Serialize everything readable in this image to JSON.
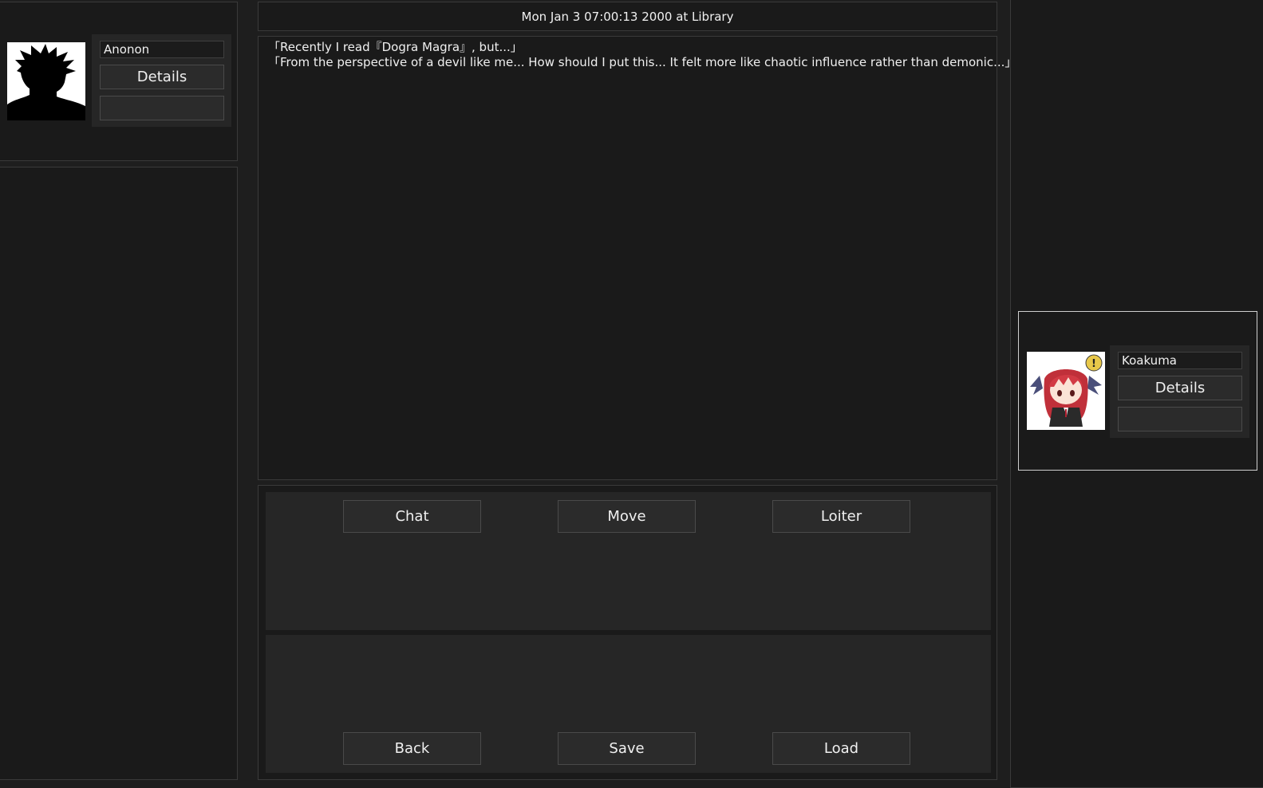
{
  "header": {
    "datetime_location": "Mon Jan  3 07:00:13 2000 at Library"
  },
  "player": {
    "name": "Anonon",
    "details_label": "Details",
    "extra_label": "",
    "portrait_icon": "silhouette-portrait"
  },
  "npc": {
    "name": "Koakuma",
    "details_label": "Details",
    "extra_label": "",
    "portrait_icon": "koakuma-chibi-portrait",
    "badge_text": "!"
  },
  "log": {
    "lines": [
      "「Recently I read『Dogra Magra』, but...」",
      "「From the perspective of a devil like me... How should I put this... It felt more like chaotic influence rather than demonic...」"
    ]
  },
  "actions": {
    "top": [
      "Chat",
      "Move",
      "Loiter"
    ],
    "bottom": [
      "Back",
      "Save",
      "Load"
    ]
  },
  "colors": {
    "background": "#1e1e1e",
    "panel": "#1a1a1a",
    "card": "#262626",
    "button": "#2b2b2b",
    "text": "#f0f0f0",
    "badge": "#e8c84a"
  }
}
